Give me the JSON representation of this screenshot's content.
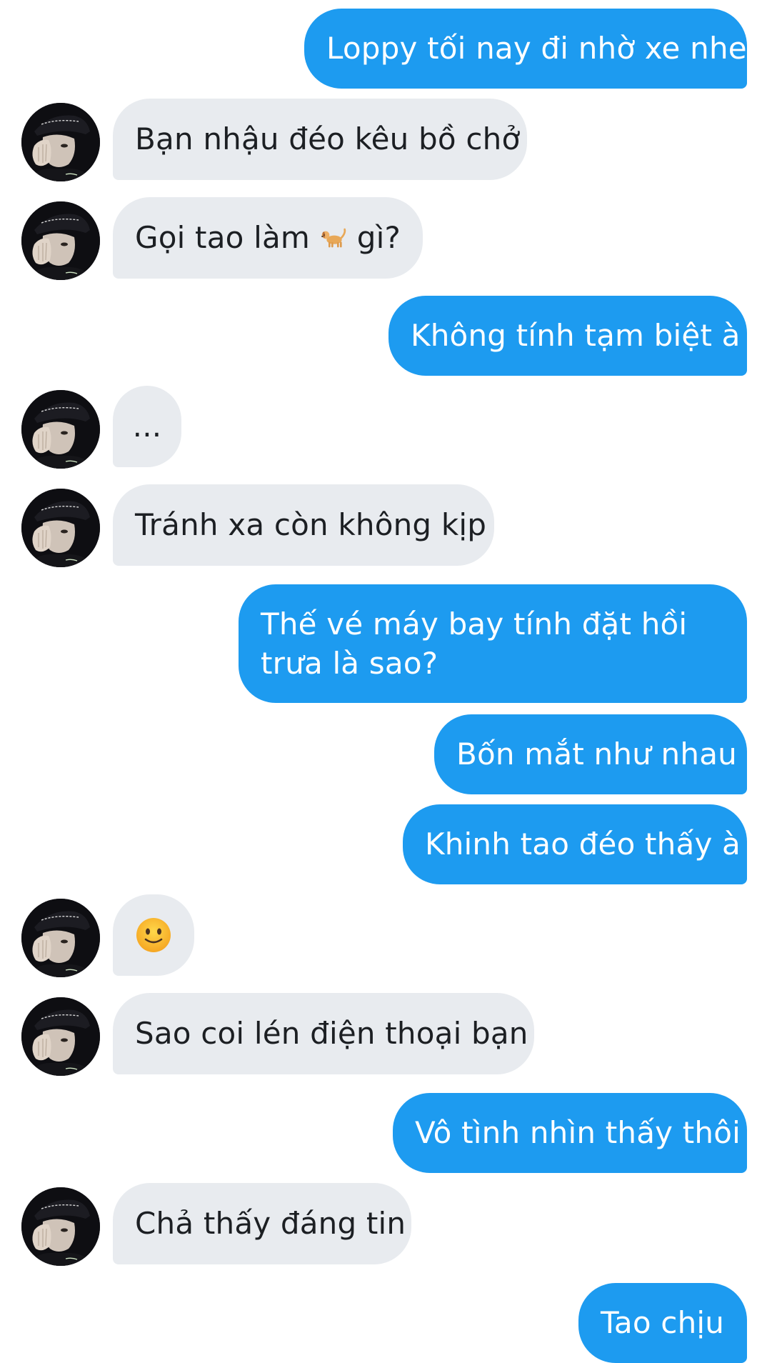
{
  "conversation": {
    "messages": [
      {
        "from": "me",
        "text": "Loppy tối nay đi nhờ xe nhe"
      },
      {
        "from": "them",
        "text": "Bạn nhậu đéo kêu bồ chở"
      },
      {
        "from": "them",
        "text_before": "Gọi tao làm ",
        "emoji": "dog-emoji",
        "text_after": " gì?"
      },
      {
        "from": "me",
        "text": "Không tính tạm biệt à"
      },
      {
        "from": "them",
        "text": "..."
      },
      {
        "from": "them",
        "text": "Tránh xa còn không kịp"
      },
      {
        "from": "me",
        "text": "Thế vé máy bay tính đặt hồi trưa là sao?"
      },
      {
        "from": "me",
        "text": "Bốn mắt như nhau"
      },
      {
        "from": "me",
        "text": "Khinh tao đéo thấy à"
      },
      {
        "from": "them",
        "emoji": "slightly-smiling-face-emoji"
      },
      {
        "from": "them",
        "text": "Sao coi lén điện thoại bạn"
      },
      {
        "from": "me",
        "text": "Vô tình nhìn thấy thôi"
      },
      {
        "from": "them",
        "text": "Chả thấy đáng tin"
      },
      {
        "from": "me",
        "text": "Tao chịu"
      }
    ]
  },
  "colors": {
    "outgoing_bubble": "#1d9bf0",
    "incoming_bubble": "#e8ebef",
    "outgoing_text": "#ffffff",
    "incoming_text": "#1c1f23"
  },
  "icons": {
    "avatar": "profile-photo-avatar",
    "dog": "dog-emoji",
    "smile": "slightly-smiling-face-emoji"
  }
}
